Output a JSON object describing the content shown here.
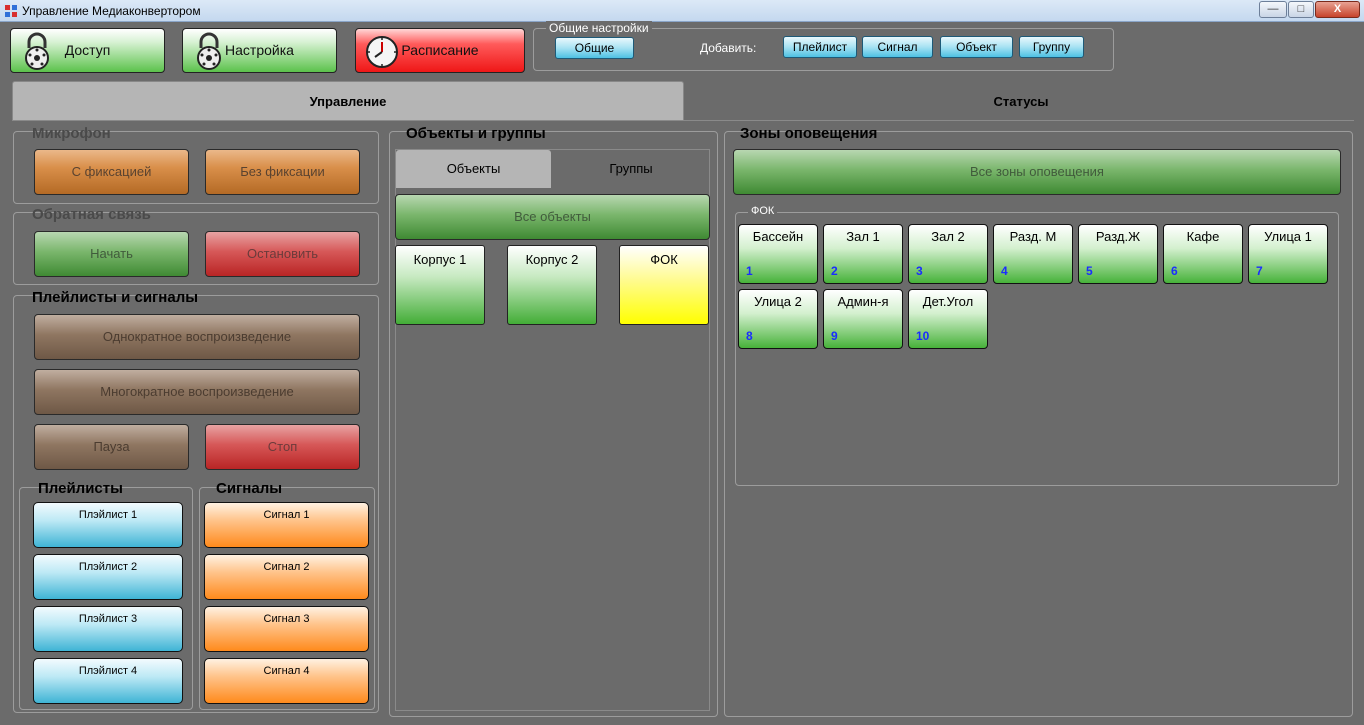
{
  "window": {
    "title": "Управление Медиаконвертором",
    "minimize": "—",
    "maximize": "□",
    "close": "X"
  },
  "toolbar": {
    "access_label": "Доступ",
    "settings_label": "Настройка",
    "schedule_label": "Расписание",
    "general_group_title": "Общие настройки",
    "general_label": "Общие",
    "add_label": "Добавить:",
    "add_playlist": "Плейлист",
    "add_signal": "Сигнал",
    "add_object": "Объект",
    "add_group": "Группу"
  },
  "tabs": {
    "control": "Управление",
    "statuses": "Статусы"
  },
  "microphone": {
    "title": "Микрофон",
    "fixed": "С фиксацией",
    "unfixed": "Без фиксации"
  },
  "feedback": {
    "title": "Обратная связь",
    "start": "Начать",
    "stop": "Остановить"
  },
  "playback": {
    "title": "Плейлисты и сигналы",
    "single": "Однократное воспроизведение",
    "multiple": "Многократное воспроизведение",
    "pause": "Пауза",
    "stop": "Стоп"
  },
  "playlists": {
    "title": "Плейлисты",
    "items": [
      "Плэйлист 1",
      "Плэйлист 2",
      "Плэйлист 3",
      "Плэйлист 4"
    ]
  },
  "signals": {
    "title": "Сигналы",
    "items": [
      "Сигнал 1",
      "Сигнал 2",
      "Сигнал 3",
      "Сигнал 4"
    ]
  },
  "objects": {
    "title": "Объекты и группы",
    "tab_objects": "Объекты",
    "tab_groups": "Группы",
    "all_objects": "Все объекты",
    "cards": [
      "Корпус 1",
      "Корпус 2",
      "ФОК"
    ]
  },
  "zones": {
    "title": "Зоны оповещения",
    "all_zones": "Все зоны оповещения",
    "group_title": "ФОК",
    "items": [
      {
        "name": "Бассейн",
        "num": "1"
      },
      {
        "name": "Зал 1",
        "num": "2"
      },
      {
        "name": "Зал 2",
        "num": "3"
      },
      {
        "name": "Разд. М",
        "num": "4"
      },
      {
        "name": "Разд.Ж",
        "num": "5"
      },
      {
        "name": "Кафе",
        "num": "6"
      },
      {
        "name": "Улица 1",
        "num": "7"
      },
      {
        "name": "Улица 2",
        "num": "8"
      },
      {
        "name": "Админ-я",
        "num": "9"
      },
      {
        "name": "Дет.Угол",
        "num": "10"
      }
    ]
  },
  "colors": {
    "zone_number": "#1a2cff",
    "background": "#6b6b6b",
    "active_tab": "#b5b5b5"
  },
  "icons": {
    "access": "lock-icon",
    "settings": "lock-icon",
    "schedule": "clock-icon"
  }
}
